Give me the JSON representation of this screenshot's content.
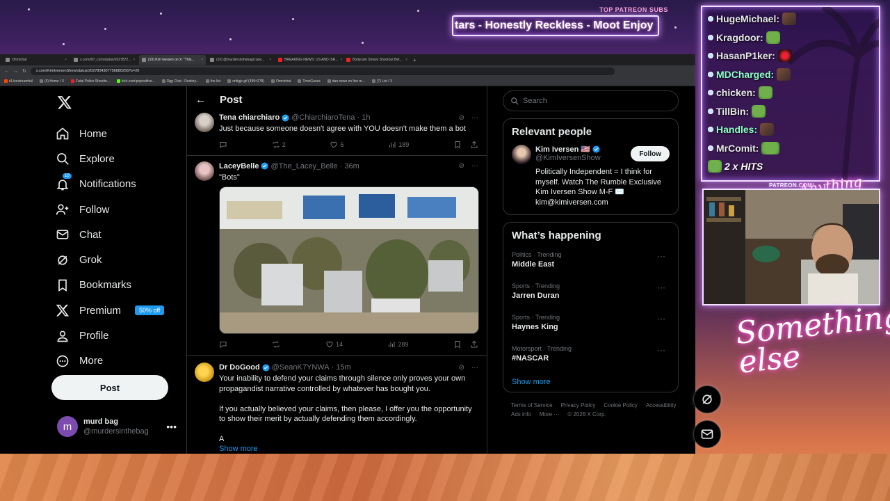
{
  "overlay": {
    "patreon_label": "TOP PATREON SUBS",
    "ticker_text": "tars - Honestly Reckless - Moot Enjoy",
    "patreon_url": "PATREON.COM/",
    "script_text_top": "Anything else?",
    "script_text_bottom": "Something else",
    "hits_text": "2 x HITS",
    "chat": [
      {
        "user": "HugeMichael:",
        "color": "#ffffff",
        "emote": "face"
      },
      {
        "user": "Kragdoor:",
        "color": "#ffffff",
        "emote": "pepe"
      },
      {
        "user": "HasanP1ker:",
        "color": "#ffffff",
        "emote": "red"
      },
      {
        "user": "MDCharged:",
        "color": "#8effc9",
        "emote": "face"
      },
      {
        "user": "chicken:",
        "color": "#ffffff",
        "emote": "pepe"
      },
      {
        "user": "TillBin:",
        "color": "#ffffff",
        "emote": "pepe"
      },
      {
        "user": "Handles:",
        "color": "#8effc9",
        "emote": "face"
      },
      {
        "user": "MrComit:",
        "color": "#ffffff",
        "emote": "pepe"
      }
    ]
  },
  "browser": {
    "tabs": [
      {
        "label": "Omnichat",
        "active": false
      },
      {
        "label": "x.com/i97_com/status/2027872...",
        "active": false
      },
      {
        "label": "(10) Kim Iversen on X: \"This...",
        "active": true
      },
      {
        "label": "(10) @murdersinthebag/cope...",
        "active": false
      },
      {
        "label": "BREAKING NEWS: US AND ISR...",
        "active": false
      },
      {
        "label": "Bodycam Shows Shootout Bet...",
        "active": false
      }
    ],
    "url": "x.com/KimIversenShow/status/2027804307756880256?s=20",
    "bookmarks": [
      "r/Livestreamfail",
      "(5) Home / X",
      "Fatal Police Shootin...",
      "kick.com/popoutlive...",
      "Dgg Chat - Destiny...",
      "the list",
      "enfigje.gif (399×278)",
      "Omnichat",
      "TimeGuess",
      "dan news on live m...",
      "(7) List / X"
    ]
  },
  "x": {
    "nav": [
      {
        "label": "Home",
        "icon": "home-icon"
      },
      {
        "label": "Explore",
        "icon": "search-icon"
      },
      {
        "label": "Notifications",
        "icon": "bell-icon",
        "badge": "10"
      },
      {
        "label": "Follow",
        "icon": "follow-icon"
      },
      {
        "label": "Chat",
        "icon": "mail-icon"
      },
      {
        "label": "Grok",
        "icon": "grok-icon"
      },
      {
        "label": "Bookmarks",
        "icon": "bookmark-icon"
      },
      {
        "label": "Premium",
        "icon": "x-logo-icon",
        "badge_text": "50% off"
      },
      {
        "label": "Profile",
        "icon": "person-icon"
      },
      {
        "label": "More",
        "icon": "more-circle-icon"
      }
    ],
    "post_button": "Post",
    "account": {
      "name": "murd bag",
      "handle": "@murdersinthebag",
      "initial": "m"
    },
    "header_title": "Post",
    "tweets": [
      {
        "name": "Tena chiarchiaro",
        "handle": "@ChiarchiaroTena",
        "time": "· 1h",
        "text": "Just because someone doesn't agree with YOU doesn't make them a bot",
        "retweets": "2",
        "likes": "6",
        "views": "189",
        "replies": ""
      },
      {
        "name": "LaceyBelle",
        "handle": "@The_Lacey_Belle",
        "time": "· 36m",
        "text": "\"Bots\"",
        "retweets": "",
        "likes": "14",
        "views": "289",
        "replies": ""
      },
      {
        "name": "Dr DoGood",
        "handle": "@SeanK7YNWA",
        "time": "· 15m",
        "text": "Your inability to defend your claims through silence only proves your own propagandist narrative controlled by whatever has bought you.\n\nIf you actually believed your claims, then please, I offer you the opportunity to show their merit by actually defending them accordingly.\n\nA",
        "show_more": "Show more"
      }
    ],
    "search_placeholder": "Search",
    "relevant": {
      "title": "Relevant people",
      "name": "Kim Iversen 🇺🇸",
      "handle": "@KimIversenShow",
      "follow": "Follow",
      "bio": "Politically Independent = I think for myself. Watch The Rumble Exclusive Kim Iversen Show M-F ✉️ kim@kimiversen.com"
    },
    "happening": {
      "title": "What’s happening",
      "trends": [
        {
          "meta": "Politics · Trending",
          "title": "Middle East"
        },
        {
          "meta": "Sports · Trending",
          "title": "Jarren Duran"
        },
        {
          "meta": "Sports · Trending",
          "title": "Haynes King"
        },
        {
          "meta": "Motorsport · Trending",
          "title": "#NASCAR"
        }
      ],
      "show_more": "Show more"
    },
    "footer": [
      "Terms of Service",
      "Privacy Policy",
      "Cookie Policy",
      "Accessibility",
      "Ads info",
      "More ···",
      "© 2026 X Corp."
    ]
  }
}
